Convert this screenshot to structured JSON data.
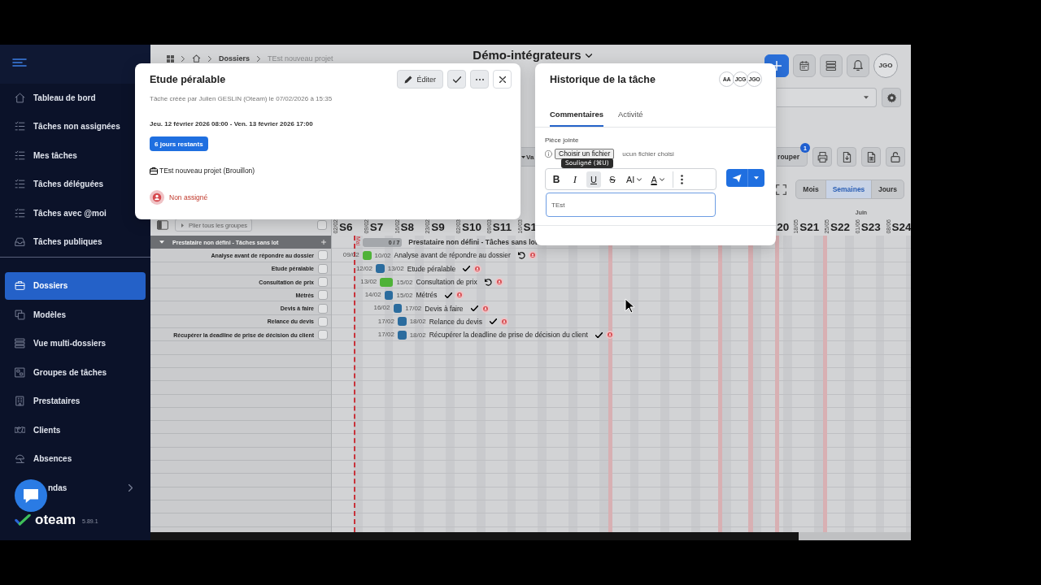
{
  "sidebar": {
    "groups": [
      {
        "items": [
          {
            "label": "Tableau de bord",
            "selected": false,
            "expandable": false,
            "covered": false
          },
          {
            "label": "Tâches non assignées",
            "selected": false,
            "expandable": false,
            "covered": false
          },
          {
            "label": "Mes tâches",
            "selected": false,
            "expandable": false,
            "covered": false
          },
          {
            "label": "Tâches déléguées",
            "selected": false,
            "expandable": false,
            "covered": false
          },
          {
            "label": "Tâches avec @moi",
            "selected": false,
            "expandable": false,
            "covered": false
          },
          {
            "label": "Tâches publiques",
            "selected": false,
            "expandable": false,
            "covered": false
          }
        ]
      },
      {
        "items": [
          {
            "label": "Dossiers",
            "selected": true,
            "expandable": false,
            "covered": false
          },
          {
            "label": "Modèles",
            "selected": false,
            "expandable": false,
            "covered": false
          },
          {
            "label": "Vue multi-dossiers",
            "selected": false,
            "expandable": false,
            "covered": false
          },
          {
            "label": "Groupes de tâches",
            "selected": false,
            "expandable": false,
            "covered": false
          },
          {
            "label": "Prestataires",
            "selected": false,
            "expandable": false,
            "covered": false
          },
          {
            "label": "Clients",
            "selected": false,
            "expandable": false,
            "covered": false
          },
          {
            "label": "Absences",
            "selected": false,
            "expandable": false,
            "covered": false
          },
          {
            "label": "ndas",
            "selected": false,
            "expandable": true,
            "covered": true
          }
        ]
      }
    ],
    "brand": {
      "name": "oteam",
      "version": "5.89.1"
    }
  },
  "topbar": {
    "breadcrumb": [
      "Dossiers",
      "TEst nouveau projet"
    ],
    "title": "Démo-intégrateurs",
    "user_initials": "JGO"
  },
  "toolbar": {
    "filter_button": "Va",
    "group_button": "rouper",
    "group_badge": "1"
  },
  "view_switch": [
    {
      "label": "Mois",
      "selected": false
    },
    {
      "label": "Semaines",
      "selected": true
    },
    {
      "label": "Jours",
      "selected": false
    }
  ],
  "gantt": {
    "collapse_button": "Plier tous les groupes",
    "select_all_checked": false,
    "weeks": [
      {
        "label": "S6",
        "date": "02/02"
      },
      {
        "label": "S7",
        "date": "09/02"
      },
      {
        "label": "S8",
        "date": "16/02"
      },
      {
        "label": "S9",
        "date": "23/02"
      },
      {
        "label": "S10",
        "date": "02/03"
      },
      {
        "label": "S11",
        "date": "09/03"
      },
      {
        "label": "S1",
        "date": "16/03"
      },
      {
        "label": "20"
      },
      {
        "label": "S21",
        "date": "18/05"
      },
      {
        "label": "S22",
        "date": "25/05"
      },
      {
        "label": "S23",
        "date": "01/06",
        "month": "Juin"
      },
      {
        "label": "S24",
        "date": "08/06"
      }
    ],
    "today": {
      "label": "Mai"
    },
    "group": {
      "name": "Prestataire non défini - Tâches sans lot",
      "bar_label": "Prestataire non défini - Tâches sans lot",
      "progress": "0 / 7",
      "expanded": true
    },
    "tasks": [
      {
        "name": "Analyse avant de répondre au dossier",
        "checked": false,
        "start": "09/02",
        "end": "10/02",
        "bar_label": "Analyse avant de répondre au dossier",
        "color": "#4fb238",
        "done": false
      },
      {
        "name": "Etude péralable",
        "checked": false,
        "start": "12/02",
        "end": "13/02",
        "bar_label": "Etude péralable",
        "color": "#2b6c9e",
        "done": true
      },
      {
        "name": "Consultation de prix",
        "checked": false,
        "start": "13/02",
        "end": "15/02",
        "bar_label": "Consultation de prix",
        "color": "#4fb238",
        "done": false
      },
      {
        "name": "Métrés",
        "checked": false,
        "start": "14/02",
        "end": "15/02",
        "bar_label": "Métrés",
        "color": "#2b6c9e",
        "done": true
      },
      {
        "name": "Devis à faire",
        "checked": false,
        "start": "16/02",
        "end": "17/02",
        "bar_label": "Devis à faire",
        "color": "#2b6c9e",
        "done": true
      },
      {
        "name": "Relance du devis",
        "checked": false,
        "start": "17/02",
        "end": "18/02",
        "bar_label": "Relance du devis",
        "color": "#2b6c9e",
        "done": true
      },
      {
        "name": "Récupérer la deadline de prise de décision du client",
        "checked": false,
        "start": "17/02",
        "end": "18/02",
        "bar_label": "Récupérer la deadline de prise de décision du client",
        "color": "#2b6c9e",
        "done": true
      }
    ]
  },
  "task_modal": {
    "title": "Etude péralable",
    "edit_button": "Éditer",
    "created": "Tâche créée par Julien GESLIN (Oteam) le 07/02/2026 à 15:35",
    "period": "Jeu. 12 février 2026 08:00 - Ven. 13 février 2026 17:00",
    "remaining": "6 jours restants",
    "project": "TEst nouveau projet (Brouillon)",
    "assignee": "Non assigné"
  },
  "history_modal": {
    "title": "Historique de la tâche",
    "participants": [
      "AA",
      "JCG",
      "JGO"
    ],
    "tabs": [
      {
        "label": "Commentaires",
        "selected": true
      },
      {
        "label": "Activité",
        "selected": false
      }
    ],
    "attachment_label": "Pièce jointe",
    "file_button": "Choisir un fichier",
    "file_status": "ucun fichier choisi",
    "tooltip": "Souligné (⌘U)",
    "format_tools": [
      {
        "kind": "bold",
        "label": "B",
        "active": false
      },
      {
        "kind": "italic",
        "label": "I",
        "active": false
      },
      {
        "kind": "underline",
        "label": "U",
        "active": true
      },
      {
        "kind": "strike",
        "label": "S",
        "active": false
      },
      {
        "kind": "size",
        "label": "AI",
        "active": false
      },
      {
        "kind": "color",
        "label": "A",
        "active": false
      }
    ],
    "comment": {
      "value": "TEst"
    }
  }
}
